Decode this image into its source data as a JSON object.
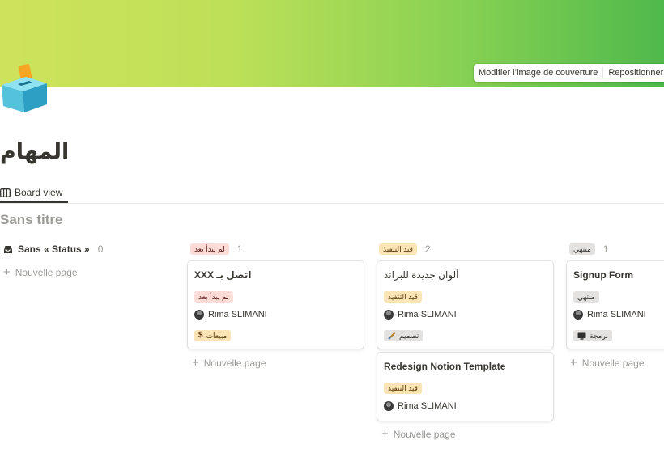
{
  "cover": {
    "change_label": "Modifier l’image de couverture",
    "reposition_label": "Repositionner"
  },
  "page": {
    "title": "المهام",
    "icon": "ballot-box-icon"
  },
  "view": {
    "tab_label": "Board view",
    "board_title": "Sans titre"
  },
  "new_page_label": "Nouvelle page",
  "groups": [
    {
      "label": "Sans « Status »",
      "count": "0"
    },
    {
      "label": "لم يبدأ بعد",
      "count": "1",
      "color": "#fddcd8"
    },
    {
      "label": "قيد التنفيذ",
      "count": "2",
      "color": "#fbe4b5"
    },
    {
      "label": "منتهي",
      "count": "1",
      "color": "#e3e2e0"
    }
  ],
  "cards": [
    {
      "title": "XXX اتصل بـ",
      "status": "لم يبدأ بعد",
      "person": "Rima SLIMANI",
      "category": "مبيعات",
      "category_icon": "dollar-icon"
    },
    {
      "title": "ألوان جديدة للبراند",
      "status": "قيد التنفيذ",
      "person": "Rima SLIMANI",
      "category": "تصميم",
      "category_icon": "paintbrush-icon"
    },
    {
      "title": "Redesign Notion Template",
      "status": "قيد التنفيذ",
      "person": "Rima SLIMANI"
    },
    {
      "title": "Signup Form",
      "status": "منتهي",
      "person": "Rima SLIMANI",
      "category": "برمجة",
      "category_icon": "computer-icon"
    }
  ]
}
